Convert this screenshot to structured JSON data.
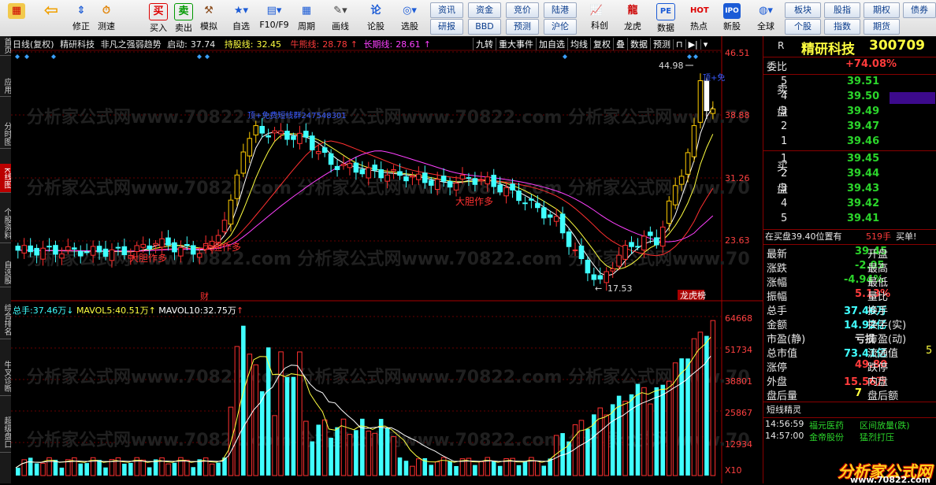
{
  "toolbar": {
    "buttons": [
      "修正",
      "测速",
      "买入",
      "卖出",
      "模拟",
      "自选",
      "F10/F9",
      "周期",
      "画线",
      "论股",
      "选股",
      "科创",
      "龙虎",
      "数据",
      "热点",
      "新股",
      "全球",
      "个股"
    ],
    "small": [
      "资讯",
      "资金",
      "竞价",
      "陆港",
      "研报",
      "BBD",
      "预测",
      "沪伦",
      "板块",
      "股指",
      "期权",
      "债券",
      "指数",
      "期货"
    ]
  },
  "left_tabs": [
    "首页",
    "应用",
    "分时图",
    "K线图",
    "个股资料",
    "自选股",
    "综合排名",
    "牛叉诊断",
    "超级盘口"
  ],
  "header": {
    "title": "日线(复权)",
    "stock": "精研科技",
    "indicator": "非凡之强弱趋势",
    "start_label": "启动:",
    "start_value": "37.74",
    "hold_label": "持股线:",
    "hold_value": "32.45",
    "bull_label": "牛熊线:",
    "bull_value": "28.78",
    "long_label": "长期线:",
    "long_value": "28.61"
  },
  "right_tools": [
    "九转",
    "重大事件",
    "加自选",
    "均线",
    "复权",
    "叠",
    "数据",
    "预测"
  ],
  "price_axis": [
    "46.51",
    "38.88",
    "31.26",
    "23.63"
  ],
  "vol_axis": [
    "64668",
    "51734",
    "38801",
    "25867",
    "12934"
  ],
  "vol_unit": "X10",
  "annotations": {
    "high": "44.98",
    "low": "17.53",
    "signal1": "大胆作多",
    "signal2": "大胆作多",
    "signal3": "大胆作多",
    "top_text": "顶+免费短线群247548301",
    "top_text2": "顶+免",
    "cai": "财",
    "longhu": "龙虎榜"
  },
  "vol_header": {
    "total_label": "总手:",
    "total": "37.46万",
    "mavol5_label": "MAVOL5:",
    "mavol5": "40.51万",
    "mavol10_label": "MAVOL10:",
    "mavol10": "32.75万"
  },
  "panel": {
    "r": "R",
    "name": "精研科技",
    "code": "300709",
    "weibi_label": "委比",
    "weibi": "+74.08%",
    "sell_label": "卖盘",
    "buy_label": "买盘",
    "sells": [
      [
        "5",
        "39.51"
      ],
      [
        "4",
        "39.50"
      ],
      [
        "3",
        "39.49"
      ],
      [
        "2",
        "39.47"
      ],
      [
        "1",
        "39.46"
      ]
    ],
    "buys": [
      [
        "1",
        "39.45"
      ],
      [
        "2",
        "39.44"
      ],
      [
        "3",
        "39.43"
      ],
      [
        "4",
        "39.42"
      ],
      [
        "5",
        "39.41"
      ]
    ],
    "inbuy": "在买盘39.40位置有",
    "inbuy_qty": "519手",
    "inbuy_tag": "买单!",
    "stats": [
      [
        "最新",
        "39.45",
        "开盘",
        ""
      ],
      [
        "涨跌",
        "-2.05",
        "最高",
        ""
      ],
      [
        "涨幅",
        "-4.94%",
        "最低",
        ""
      ],
      [
        "振幅",
        "5.13%",
        "量比",
        ""
      ],
      [
        "总手",
        "37.46万",
        "换手",
        ""
      ],
      [
        "金额",
        "14.92亿",
        "换手(实)",
        ""
      ],
      [
        "市盈(静)",
        "亏损",
        "市盈(动)",
        ""
      ],
      [
        "总市值",
        "73.41亿",
        "流通值",
        "5"
      ],
      [
        "涨停",
        "49.80",
        "跌停",
        ""
      ],
      [
        "外盘",
        "15.56万",
        "内盘",
        ""
      ],
      [
        "盘后量",
        "7",
        "盘后额",
        ""
      ]
    ],
    "jl_title": "短线精灵",
    "jl": [
      [
        "14:56:59",
        "福元医药",
        "区间放量(跌)"
      ],
      [
        "14:57:00",
        "金帝股份",
        "猛烈打压"
      ]
    ]
  },
  "watermark": "分析家公式网",
  "watermark_url": "www.70822.com"
}
